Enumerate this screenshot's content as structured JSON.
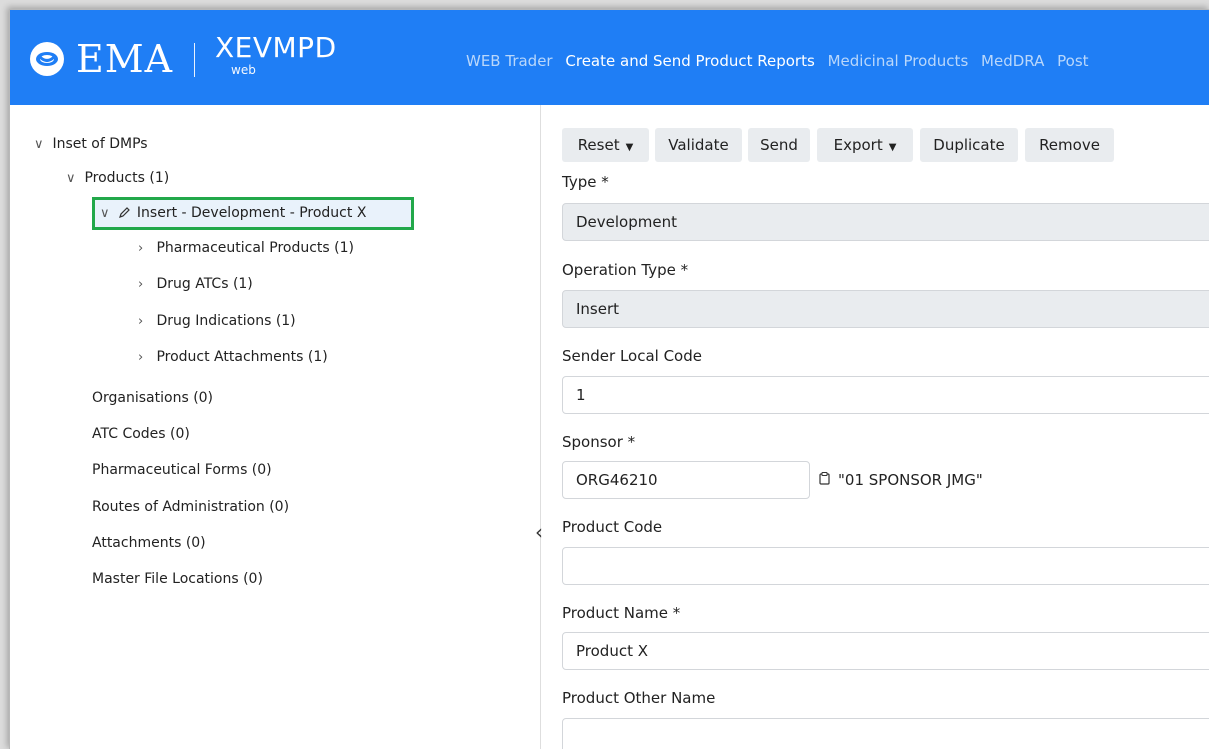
{
  "header": {
    "brand": "EMA",
    "product": "XEVMPD",
    "product_sub": "web",
    "nav": [
      "WEB Trader",
      "Create and Send Product Reports",
      "Medicinal Products",
      "MedDRA",
      "Post"
    ],
    "active_nav": "Create and Send Product Reports"
  },
  "tree": {
    "root": "Inset of DMPs",
    "products": "Products (1)",
    "selected": "Insert - Development - Product X",
    "children": [
      "Pharmaceutical Products (1)",
      "Drug ATCs (1)",
      "Drug Indications (1)",
      "Product Attachments (1)"
    ],
    "sections": [
      "Organisations (0)",
      "ATC Codes (0)",
      "Pharmaceutical Forms (0)",
      "Routes of Administration (0)",
      "Attachments (0)",
      "Master File Locations (0)"
    ]
  },
  "toolbar": {
    "reset": "Reset",
    "validate": "Validate",
    "send": "Send",
    "export": "Export",
    "duplicate": "Duplicate",
    "remove": "Remove"
  },
  "form": {
    "type_label": "Type *",
    "type_value": "Development",
    "operation_label": "Operation Type *",
    "operation_value": "Insert",
    "sender_label": "Sender Local Code",
    "sender_value": "1",
    "sponsor_label": "Sponsor *",
    "sponsor_value": "ORG46210",
    "sponsor_name": "\"01 SPONSOR JMG\"",
    "product_code_label": "Product Code",
    "product_code_value": "",
    "product_name_label": "Product Name *",
    "product_name_value": "Product X",
    "product_other_label": "Product Other Name",
    "product_other_value": ""
  },
  "colors": {
    "header_bg": "#1f7ef5",
    "highlight_border": "#22a84a",
    "button_bg": "#e9ecef"
  }
}
